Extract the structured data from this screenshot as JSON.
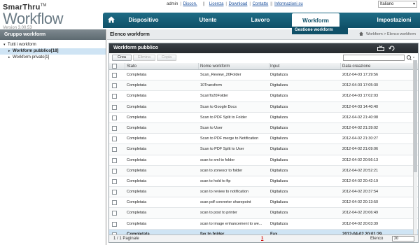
{
  "app": {
    "brand_small": "SmarThru",
    "brand_tm": "TM",
    "brand_big": "Workflow",
    "version": "Version 3.00.53"
  },
  "top_links": {
    "user": "admin",
    "logout": "Discon.",
    "license": "Licenza",
    "download": "Download",
    "contact": "Contatto",
    "info": "Informazioni su",
    "language": "Italiano"
  },
  "nav": {
    "items": [
      "Dispositivo",
      "Utente",
      "Lavoro",
      "Workform",
      "Impostazioni"
    ],
    "active": "Workform",
    "dropdown_item": "Gestione workform"
  },
  "sidebar": {
    "title": "Gruppo workform",
    "root": "Tutti i workform",
    "children": [
      "Workform pubblico[18]",
      "Workform privato[1]"
    ]
  },
  "main": {
    "title": "Elenco workform",
    "breadcrumb": "Workform > Elenco workform",
    "panel_title": "Workform pubblico"
  },
  "toolbar": {
    "create": "Crea",
    "delete": "Elimina",
    "copy": "Copia"
  },
  "table": {
    "headers": [
      "Stato",
      "Nome workform",
      "Input",
      "Data creazione"
    ],
    "rows": [
      [
        "Completata",
        "Scan_Review_20Folder",
        "Digitalizza",
        "2012-04-03 17:29:56"
      ],
      [
        "Completata",
        "10Transform",
        "Digitalizza",
        "2012-04-03 17:05:30"
      ],
      [
        "Completata",
        "ScanTo20Folder",
        "Digitalizza",
        "2012-04-03 17:02:03"
      ],
      [
        "Completata",
        "Scan to Google Docs",
        "Digitalizza",
        "2012-04-03 14:40:40"
      ],
      [
        "Completata",
        "Scan to PDF Split to Folder",
        "Digitalizza",
        "2012-04-02 21:40:08"
      ],
      [
        "Completata",
        "Scan to User",
        "Digitalizza",
        "2012-04-02 21:39:02"
      ],
      [
        "Completata",
        "Scan to PDF merge to Notification",
        "Digitalizza",
        "2012-04-02 21:30:27"
      ],
      [
        "Completata",
        "Scan to PDF Split to User",
        "Digitalizza",
        "2012-04-02 21:09:06"
      ],
      [
        "Completata",
        "scan to xml to folder",
        "Digitalizza",
        "2012-04-02 20:56:13"
      ],
      [
        "Completata",
        "scan to zoneocr to folder",
        "Digitalizza",
        "2012-04-02 20:52:21"
      ],
      [
        "Completata",
        "scan to hold to ftp",
        "Digitalizza",
        "2012-04-02 20:42:19"
      ],
      [
        "Completata",
        "scan to review to notification",
        "Digitalizza",
        "2012-04-02 20:37:54"
      ],
      [
        "Completata",
        "scan pdf converter sharepoint",
        "Digitalizza",
        "2012-04-02 20:13:50"
      ],
      [
        "Completata",
        "scan to post to printer",
        "Digitalizza",
        "2012-04-02 20:06:49"
      ],
      [
        "Completata",
        "scan to image enhancement to we...",
        "Digitalizza",
        "2012-04-02 20:03:39"
      ],
      [
        "Completata",
        "fax to folder",
        "Fax",
        "2012-04-02 20:01:29"
      ]
    ],
    "selected_index": 15
  },
  "footer": {
    "pages": "1 / 1 Paginale",
    "current_page": "1",
    "per_page_label": "Elenco",
    "per_page_value": "20"
  }
}
